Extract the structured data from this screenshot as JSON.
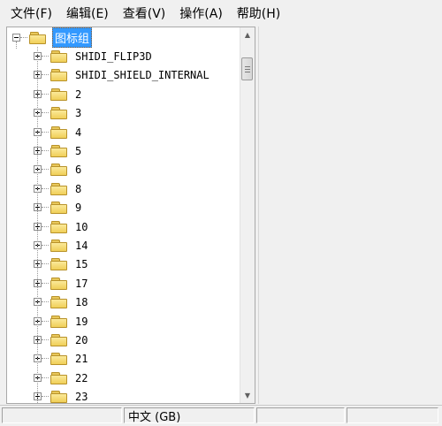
{
  "menu": {
    "items": [
      {
        "label": "文件(F)"
      },
      {
        "label": "编辑(E)"
      },
      {
        "label": "查看(V)"
      },
      {
        "label": "操作(A)"
      },
      {
        "label": "帮助(H)"
      }
    ]
  },
  "tree": {
    "root": {
      "label": "图标组",
      "expanded": true,
      "selected": true
    },
    "children": [
      {
        "label": "SHIDI_FLIP3D"
      },
      {
        "label": "SHIDI_SHIELD_INTERNAL"
      },
      {
        "label": "2"
      },
      {
        "label": "3"
      },
      {
        "label": "4"
      },
      {
        "label": "5"
      },
      {
        "label": "6"
      },
      {
        "label": "8"
      },
      {
        "label": "9"
      },
      {
        "label": "10"
      },
      {
        "label": "14"
      },
      {
        "label": "15"
      },
      {
        "label": "17"
      },
      {
        "label": "18"
      },
      {
        "label": "19"
      },
      {
        "label": "20"
      },
      {
        "label": "21"
      },
      {
        "label": "22"
      },
      {
        "label": "23"
      }
    ]
  },
  "scrollbar": {
    "up_arrow": "▲",
    "down_arrow": "▼"
  },
  "statusbar": {
    "cells": [
      {
        "text": ""
      },
      {
        "text": "中文 (GB)"
      },
      {
        "text": ""
      },
      {
        "text": ""
      }
    ]
  },
  "colors": {
    "selection": "#3399ff",
    "folder": "#f0cf58",
    "window": "#f0f0f0"
  }
}
